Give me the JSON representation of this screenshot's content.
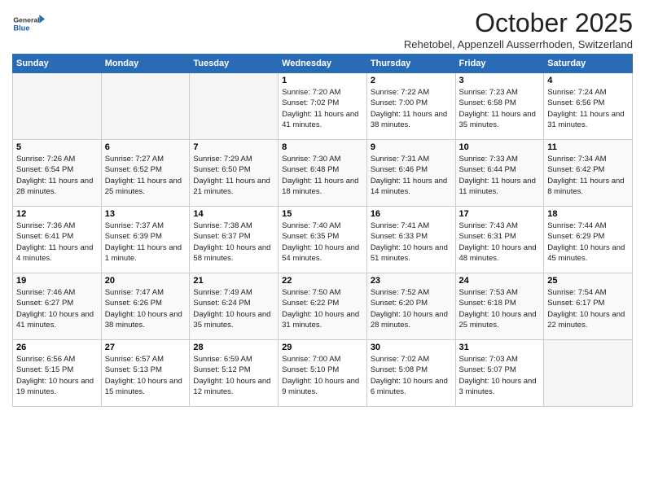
{
  "logo": {
    "general": "General",
    "blue": "Blue"
  },
  "header": {
    "month": "October 2025",
    "subtitle": "Rehetobel, Appenzell Ausserrhoden, Switzerland"
  },
  "days_of_week": [
    "Sunday",
    "Monday",
    "Tuesday",
    "Wednesday",
    "Thursday",
    "Friday",
    "Saturday"
  ],
  "weeks": [
    [
      {
        "day": "",
        "sunrise": "",
        "sunset": "",
        "daylight": ""
      },
      {
        "day": "",
        "sunrise": "",
        "sunset": "",
        "daylight": ""
      },
      {
        "day": "",
        "sunrise": "",
        "sunset": "",
        "daylight": ""
      },
      {
        "day": "1",
        "sunrise": "Sunrise: 7:20 AM",
        "sunset": "Sunset: 7:02 PM",
        "daylight": "Daylight: 11 hours and 41 minutes."
      },
      {
        "day": "2",
        "sunrise": "Sunrise: 7:22 AM",
        "sunset": "Sunset: 7:00 PM",
        "daylight": "Daylight: 11 hours and 38 minutes."
      },
      {
        "day": "3",
        "sunrise": "Sunrise: 7:23 AM",
        "sunset": "Sunset: 6:58 PM",
        "daylight": "Daylight: 11 hours and 35 minutes."
      },
      {
        "day": "4",
        "sunrise": "Sunrise: 7:24 AM",
        "sunset": "Sunset: 6:56 PM",
        "daylight": "Daylight: 11 hours and 31 minutes."
      }
    ],
    [
      {
        "day": "5",
        "sunrise": "Sunrise: 7:26 AM",
        "sunset": "Sunset: 6:54 PM",
        "daylight": "Daylight: 11 hours and 28 minutes."
      },
      {
        "day": "6",
        "sunrise": "Sunrise: 7:27 AM",
        "sunset": "Sunset: 6:52 PM",
        "daylight": "Daylight: 11 hours and 25 minutes."
      },
      {
        "day": "7",
        "sunrise": "Sunrise: 7:29 AM",
        "sunset": "Sunset: 6:50 PM",
        "daylight": "Daylight: 11 hours and 21 minutes."
      },
      {
        "day": "8",
        "sunrise": "Sunrise: 7:30 AM",
        "sunset": "Sunset: 6:48 PM",
        "daylight": "Daylight: 11 hours and 18 minutes."
      },
      {
        "day": "9",
        "sunrise": "Sunrise: 7:31 AM",
        "sunset": "Sunset: 6:46 PM",
        "daylight": "Daylight: 11 hours and 14 minutes."
      },
      {
        "day": "10",
        "sunrise": "Sunrise: 7:33 AM",
        "sunset": "Sunset: 6:44 PM",
        "daylight": "Daylight: 11 hours and 11 minutes."
      },
      {
        "day": "11",
        "sunrise": "Sunrise: 7:34 AM",
        "sunset": "Sunset: 6:42 PM",
        "daylight": "Daylight: 11 hours and 8 minutes."
      }
    ],
    [
      {
        "day": "12",
        "sunrise": "Sunrise: 7:36 AM",
        "sunset": "Sunset: 6:41 PM",
        "daylight": "Daylight: 11 hours and 4 minutes."
      },
      {
        "day": "13",
        "sunrise": "Sunrise: 7:37 AM",
        "sunset": "Sunset: 6:39 PM",
        "daylight": "Daylight: 11 hours and 1 minute."
      },
      {
        "day": "14",
        "sunrise": "Sunrise: 7:38 AM",
        "sunset": "Sunset: 6:37 PM",
        "daylight": "Daylight: 10 hours and 58 minutes."
      },
      {
        "day": "15",
        "sunrise": "Sunrise: 7:40 AM",
        "sunset": "Sunset: 6:35 PM",
        "daylight": "Daylight: 10 hours and 54 minutes."
      },
      {
        "day": "16",
        "sunrise": "Sunrise: 7:41 AM",
        "sunset": "Sunset: 6:33 PM",
        "daylight": "Daylight: 10 hours and 51 minutes."
      },
      {
        "day": "17",
        "sunrise": "Sunrise: 7:43 AM",
        "sunset": "Sunset: 6:31 PM",
        "daylight": "Daylight: 10 hours and 48 minutes."
      },
      {
        "day": "18",
        "sunrise": "Sunrise: 7:44 AM",
        "sunset": "Sunset: 6:29 PM",
        "daylight": "Daylight: 10 hours and 45 minutes."
      }
    ],
    [
      {
        "day": "19",
        "sunrise": "Sunrise: 7:46 AM",
        "sunset": "Sunset: 6:27 PM",
        "daylight": "Daylight: 10 hours and 41 minutes."
      },
      {
        "day": "20",
        "sunrise": "Sunrise: 7:47 AM",
        "sunset": "Sunset: 6:26 PM",
        "daylight": "Daylight: 10 hours and 38 minutes."
      },
      {
        "day": "21",
        "sunrise": "Sunrise: 7:49 AM",
        "sunset": "Sunset: 6:24 PM",
        "daylight": "Daylight: 10 hours and 35 minutes."
      },
      {
        "day": "22",
        "sunrise": "Sunrise: 7:50 AM",
        "sunset": "Sunset: 6:22 PM",
        "daylight": "Daylight: 10 hours and 31 minutes."
      },
      {
        "day": "23",
        "sunrise": "Sunrise: 7:52 AM",
        "sunset": "Sunset: 6:20 PM",
        "daylight": "Daylight: 10 hours and 28 minutes."
      },
      {
        "day": "24",
        "sunrise": "Sunrise: 7:53 AM",
        "sunset": "Sunset: 6:18 PM",
        "daylight": "Daylight: 10 hours and 25 minutes."
      },
      {
        "day": "25",
        "sunrise": "Sunrise: 7:54 AM",
        "sunset": "Sunset: 6:17 PM",
        "daylight": "Daylight: 10 hours and 22 minutes."
      }
    ],
    [
      {
        "day": "26",
        "sunrise": "Sunrise: 6:56 AM",
        "sunset": "Sunset: 5:15 PM",
        "daylight": "Daylight: 10 hours and 19 minutes."
      },
      {
        "day": "27",
        "sunrise": "Sunrise: 6:57 AM",
        "sunset": "Sunset: 5:13 PM",
        "daylight": "Daylight: 10 hours and 15 minutes."
      },
      {
        "day": "28",
        "sunrise": "Sunrise: 6:59 AM",
        "sunset": "Sunset: 5:12 PM",
        "daylight": "Daylight: 10 hours and 12 minutes."
      },
      {
        "day": "29",
        "sunrise": "Sunrise: 7:00 AM",
        "sunset": "Sunset: 5:10 PM",
        "daylight": "Daylight: 10 hours and 9 minutes."
      },
      {
        "day": "30",
        "sunrise": "Sunrise: 7:02 AM",
        "sunset": "Sunset: 5:08 PM",
        "daylight": "Daylight: 10 hours and 6 minutes."
      },
      {
        "day": "31",
        "sunrise": "Sunrise: 7:03 AM",
        "sunset": "Sunset: 5:07 PM",
        "daylight": "Daylight: 10 hours and 3 minutes."
      },
      {
        "day": "",
        "sunrise": "",
        "sunset": "",
        "daylight": ""
      }
    ]
  ]
}
